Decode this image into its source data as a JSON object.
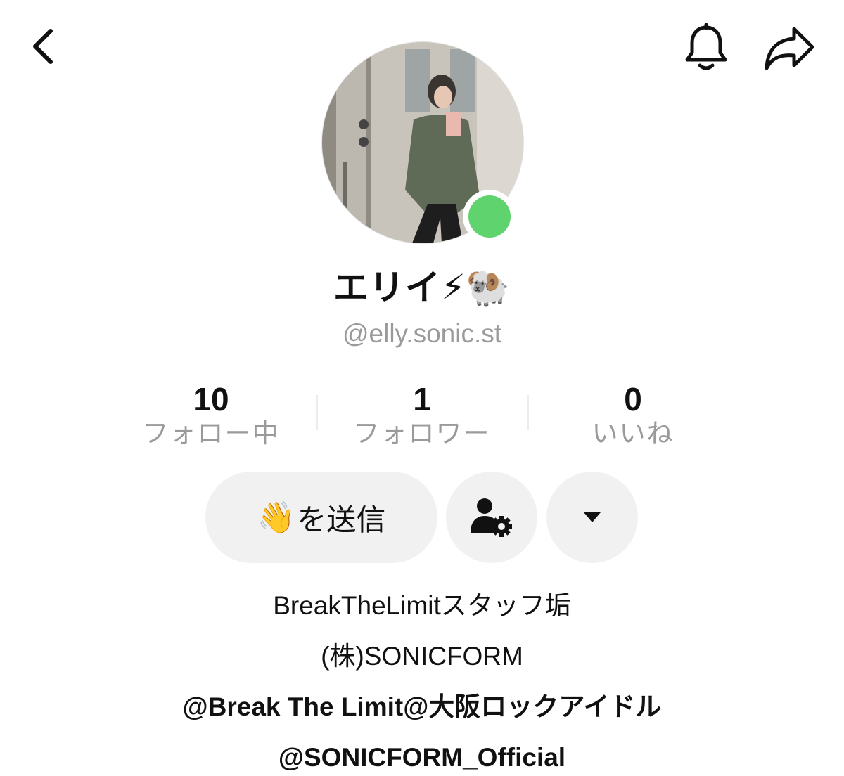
{
  "profile": {
    "display_name": "エリイ⚡🐏",
    "username": "@elly.sonic.st",
    "online_status_color": "#5fd36e"
  },
  "header": {
    "back_icon": "chevron-left-icon",
    "bell_icon": "bell-icon",
    "share_icon": "share-arrow-icon"
  },
  "stats": [
    {
      "value": "10",
      "label": "フォロー中"
    },
    {
      "value": "1",
      "label": "フォロワー"
    },
    {
      "value": "0",
      "label": "いいね"
    }
  ],
  "actions": {
    "wave_emoji": "👋",
    "wave_label": "を送信",
    "user_settings_icon": "user-gear-icon",
    "more_icon": "caret-down-icon"
  },
  "bio": {
    "line1": "BreakTheLimitスタッフ垢",
    "line2": "(株)SONICFORM",
    "line3": "@Break The Limit@大阪ロックアイドル",
    "line4": "@SONICFORM_Official"
  }
}
